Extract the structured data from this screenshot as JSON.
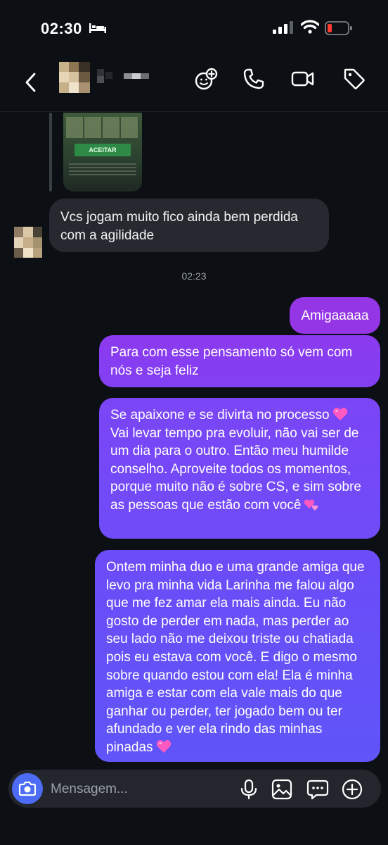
{
  "status_bar": {
    "time": "02:30"
  },
  "messages": {
    "incoming": {
      "text": "Vcs jogam muito fico ainda bem perdida com a agilidade"
    },
    "preview": {
      "button_label": "ACEITAR"
    },
    "timestamp": "02:23",
    "outgoing": [
      {
        "text": "Amigaaaaa"
      },
      {
        "text": "Para com esse pensamento só vem com nós e seja feliz"
      },
      {
        "text": "Se apaixone e se divirta no processo",
        "text_2": "Vai levar tempo pra evoluir, não vai ser de um dia para o outro. Então meu humilde conselho. Aproveite todos os momentos, porque muito não é sobre CS, e sim sobre as pessoas que estão com você"
      },
      {
        "text": "Ontem minha duo e uma grande amiga que levo pra minha vida Larinha me falou algo que me fez amar ela mais ainda. Eu não gosto de perder em nada, mas perder ao seu lado não me deixou triste ou chatiada pois eu estava com você. E digo o mesmo sobre quando estou com ela! Ela é minha amiga e estar com ela vale mais do que ganhar ou perder, ter jogado bem ou ter afundado e ver ela rindo das minhas pinadas"
      }
    ]
  },
  "composer": {
    "placeholder": "Mensagem..."
  },
  "icons": {
    "header": [
      "back-icon",
      "sticker-add-icon",
      "phone-icon",
      "video-icon",
      "tag-icon"
    ],
    "composer": [
      "camera-icon",
      "microphone-icon",
      "image-icon",
      "chat-bubble-icon",
      "plus-circle-icon"
    ]
  },
  "colors": {
    "background": "#0c0f13",
    "incoming_bubble": "#26292f",
    "outgoing_top": "#9435e6",
    "outgoing_bottom": "#5f55f9",
    "camera_button": "#4c6cf6"
  }
}
